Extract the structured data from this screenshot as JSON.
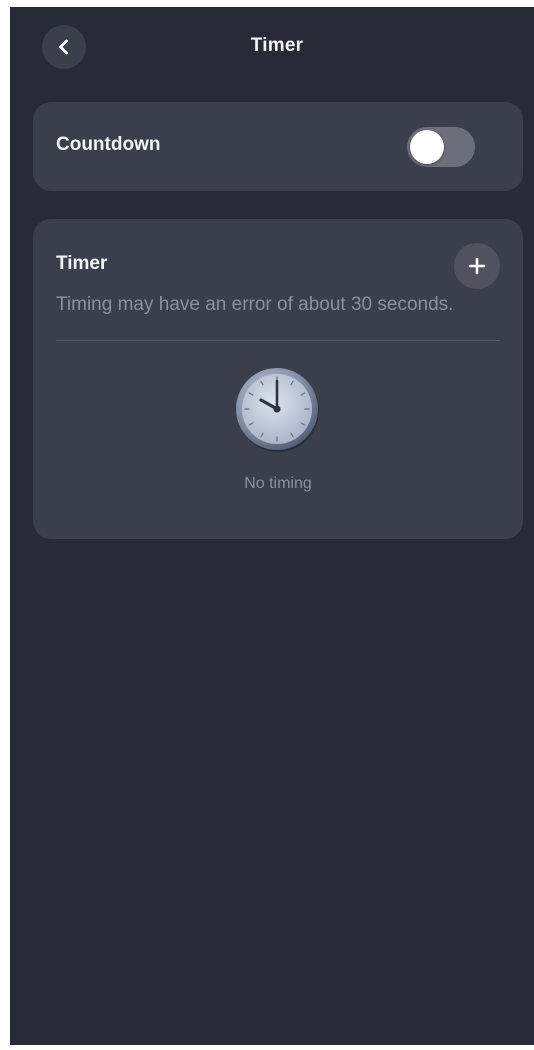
{
  "header": {
    "title": "Timer",
    "back_icon": "chevron-left-icon"
  },
  "countdown": {
    "label": "Countdown",
    "toggle_on": false
  },
  "timer": {
    "title": "Timer",
    "note": "Timing may have an error of about 30 seconds.",
    "add_icon": "plus-icon",
    "empty_icon": "clock-icon",
    "empty_text": "No timing"
  },
  "colors": {
    "background": "#282a37",
    "card": "#3b3e4c",
    "text_primary": "#f2f3f6",
    "text_secondary": "#8d909c",
    "toggle_off": "#6d6f7c"
  }
}
